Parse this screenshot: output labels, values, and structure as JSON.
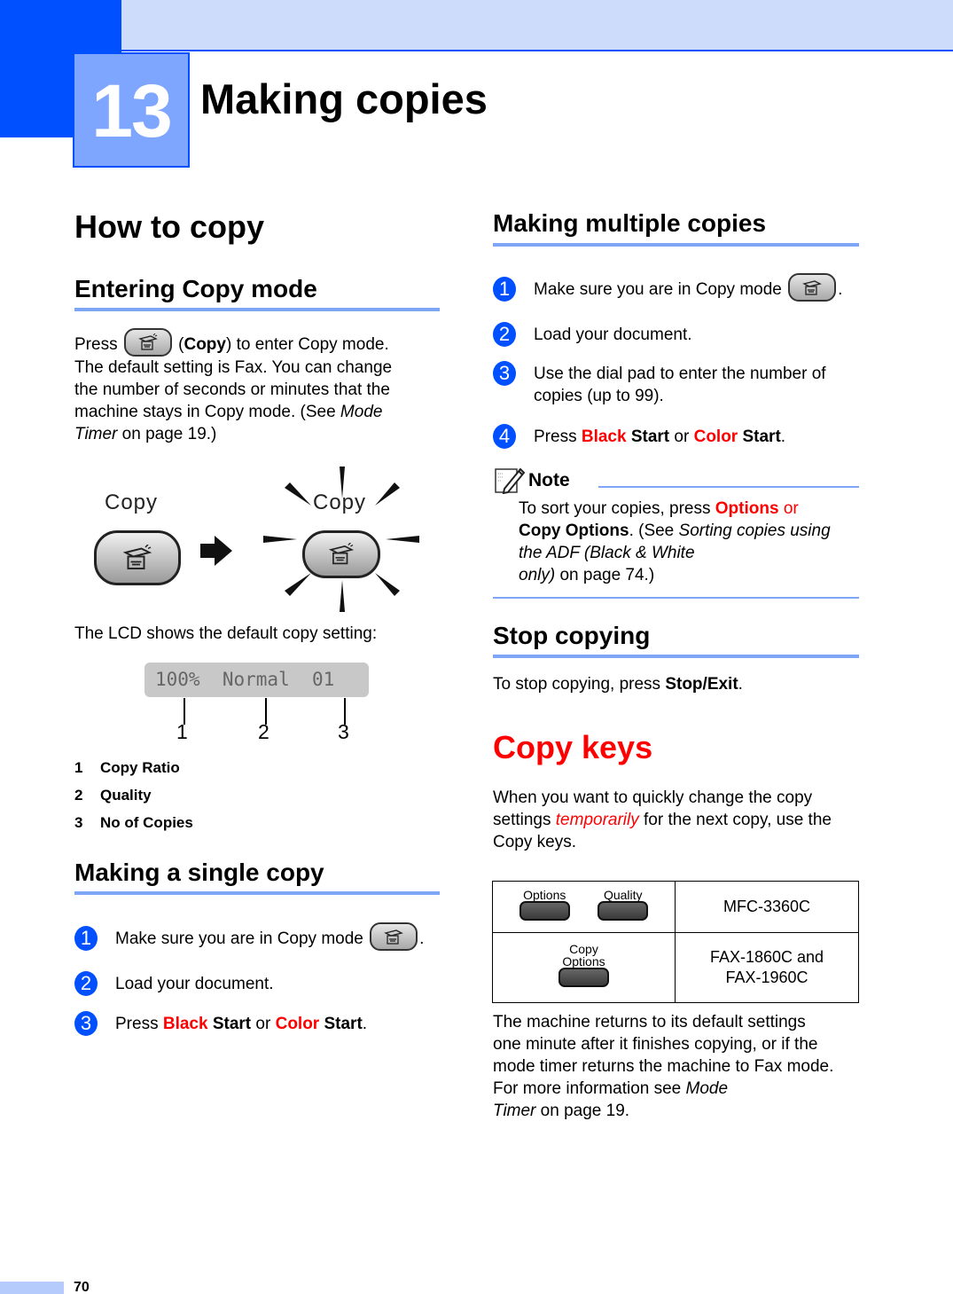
{
  "chapter": {
    "number": "13",
    "title": "Making copies"
  },
  "left": {
    "how_to_copy": "How to copy",
    "entering": {
      "heading": "Entering Copy mode",
      "press": "Press",
      "copy_bold": "Copy",
      "after_copy": ") to enter Copy mode.",
      "lines": [
        "The default setting is Fax. You can change",
        "the number of seconds or minutes that the",
        "machine stays in Copy mode. (See "
      ],
      "mode_italic": "Mode",
      "timer_italic": "Timer",
      "on_page": " on page 19.)"
    },
    "illustration": {
      "label_before": "Copy",
      "label_after": "Copy",
      "button_icon": "copy-machine-icon",
      "arrow_icon": "right-arrow-icon"
    },
    "lcd_intro": "The LCD shows the default copy setting:",
    "lcd": {
      "text": "100%  Normal  01",
      "callouts": [
        "1",
        "2",
        "3"
      ]
    },
    "legend": [
      {
        "num": "1",
        "label": "Copy Ratio"
      },
      {
        "num": "2",
        "label": "Quality"
      },
      {
        "num": "3",
        "label": "No of Copies"
      }
    ],
    "single": {
      "heading": "Making a single copy",
      "steps": [
        {
          "num": "1",
          "text": "Make sure you are in Copy mode"
        },
        {
          "num": "2",
          "text": "Load your document."
        },
        {
          "num": "3",
          "press": "Press ",
          "black": "Black",
          "start1": " Start",
          "or": " or ",
          "color": "Color",
          "start2": " Start",
          "end": "."
        }
      ]
    }
  },
  "right": {
    "multiple": {
      "heading": "Making multiple copies",
      "steps": [
        {
          "num": "1",
          "text": "Make sure you are in Copy mode"
        },
        {
          "num": "2",
          "text": "Load your document."
        },
        {
          "num": "3",
          "line1": "Use the dial pad to enter the number of",
          "line2": "copies (up to 99)."
        },
        {
          "num": "4",
          "press": "Press ",
          "black": "Black",
          "start1": " Start",
          "or": " or ",
          "color": "Color",
          "start2": " Start",
          "end": "."
        }
      ]
    },
    "note": {
      "title": "Note",
      "l1_pre": "To sort your copies, press ",
      "l1_options": "Options",
      "l1_or": " or",
      "l2_bold": "Copy Options",
      "l2_mid": ". (See ",
      "l2_italic": "Sorting copies using",
      "l3_italic": "the ADF (Black & White",
      "l4_italic": "only)",
      "l4_rest": " on page 74.)"
    },
    "stop": {
      "heading": "Stop copying",
      "pre": "To stop copying, press ",
      "bold": "Stop/Exit",
      "end": "."
    },
    "copy_keys": {
      "heading": "Copy keys",
      "l1": "When you want to quickly change the copy",
      "l2_pre": "settings ",
      "l2_italic": "temporarily",
      "l2_post": " for the next copy, use the",
      "l3": "Copy keys."
    },
    "keys_table": {
      "rows": [
        {
          "keys": [
            "Options",
            "Quality"
          ],
          "model": "MFC-3360C"
        },
        {
          "keys": [
            "Copy Options"
          ],
          "key_line1": "Copy",
          "key_line2": "Options",
          "model_l1": "FAX-1860C and",
          "model_l2": "FAX-1960C"
        }
      ]
    },
    "closing": {
      "l1": "The machine returns to its default settings",
      "l2": "one minute after it finishes copying, or if the",
      "l3": "mode timer returns the machine to Fax mode.",
      "l4_pre": "For more information see ",
      "l4_italic": "Mode",
      "l5_italic": "Timer",
      "l5_post": " on page 19."
    }
  },
  "footer": {
    "page_number": "70"
  },
  "colors": {
    "accent_blue": "#0050ff",
    "rule_blue": "#7fa6f6",
    "highlight_red": "#ff0000"
  }
}
